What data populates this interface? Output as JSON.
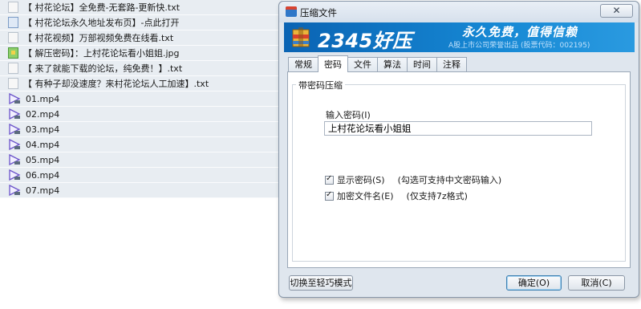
{
  "files": [
    {
      "name": "【 村花论坛】全免费-无套路-更新快.txt",
      "icon": "txt-file-icon"
    },
    {
      "name": "【 村花论坛永久地址发布页】-点此打开",
      "icon": "internet-shortcut-icon"
    },
    {
      "name": "【 村花视频】万部视频免费在线看.txt",
      "icon": "txt-file-icon"
    },
    {
      "name": "【 解压密码】：上村花论坛看小姐姐.jpg",
      "icon": "jpg-file-icon"
    },
    {
      "name": "【 来了就能下载的论坛，纯免费！】.txt",
      "icon": "txt-file-icon"
    },
    {
      "name": "【 有种子却没速度？来村花论坛人工加速】.txt",
      "icon": "txt-file-icon"
    },
    {
      "name": "01.mp4",
      "icon": "mp4-file-icon"
    },
    {
      "name": "02.mp4",
      "icon": "mp4-file-icon"
    },
    {
      "name": "03.mp4",
      "icon": "mp4-file-icon"
    },
    {
      "name": "04.mp4",
      "icon": "mp4-file-icon"
    },
    {
      "name": "05.mp4",
      "icon": "mp4-file-icon"
    },
    {
      "name": "06.mp4",
      "icon": "mp4-file-icon"
    },
    {
      "name": "07.mp4",
      "icon": "mp4-file-icon"
    }
  ],
  "dialog": {
    "title": "压缩文件",
    "close_label": "✕",
    "banner": {
      "brand": "2345好压",
      "slogan": "永久免费，值得信赖",
      "subtitle": "A股上市公司荣誉出品 (股票代码：002195)"
    },
    "tabs": [
      {
        "label": "常规",
        "active": false
      },
      {
        "label": "密码",
        "active": true
      },
      {
        "label": "文件",
        "active": false
      },
      {
        "label": "算法",
        "active": false
      },
      {
        "label": "时间",
        "active": false
      },
      {
        "label": "注释",
        "active": false
      }
    ],
    "group_label": "带密码压缩",
    "password_label": "输入密码(I)",
    "password_value": "上村花论坛看小姐姐",
    "show_password": {
      "label": "显示密码(S)",
      "note": "(勾选可支持中文密码输入)",
      "checked": true
    },
    "encrypt_names": {
      "label": "加密文件名(E)",
      "note": "(仅支持7z格式)",
      "checked": true
    },
    "lite_mode_button": "切换至轻巧模式",
    "ok_button": "确定(O)",
    "cancel_button": "取消(C)"
  },
  "colors": {
    "banner": "#1688d4",
    "list_bg": "#e8edf2",
    "dialog_bg": "#dfe6ee"
  }
}
